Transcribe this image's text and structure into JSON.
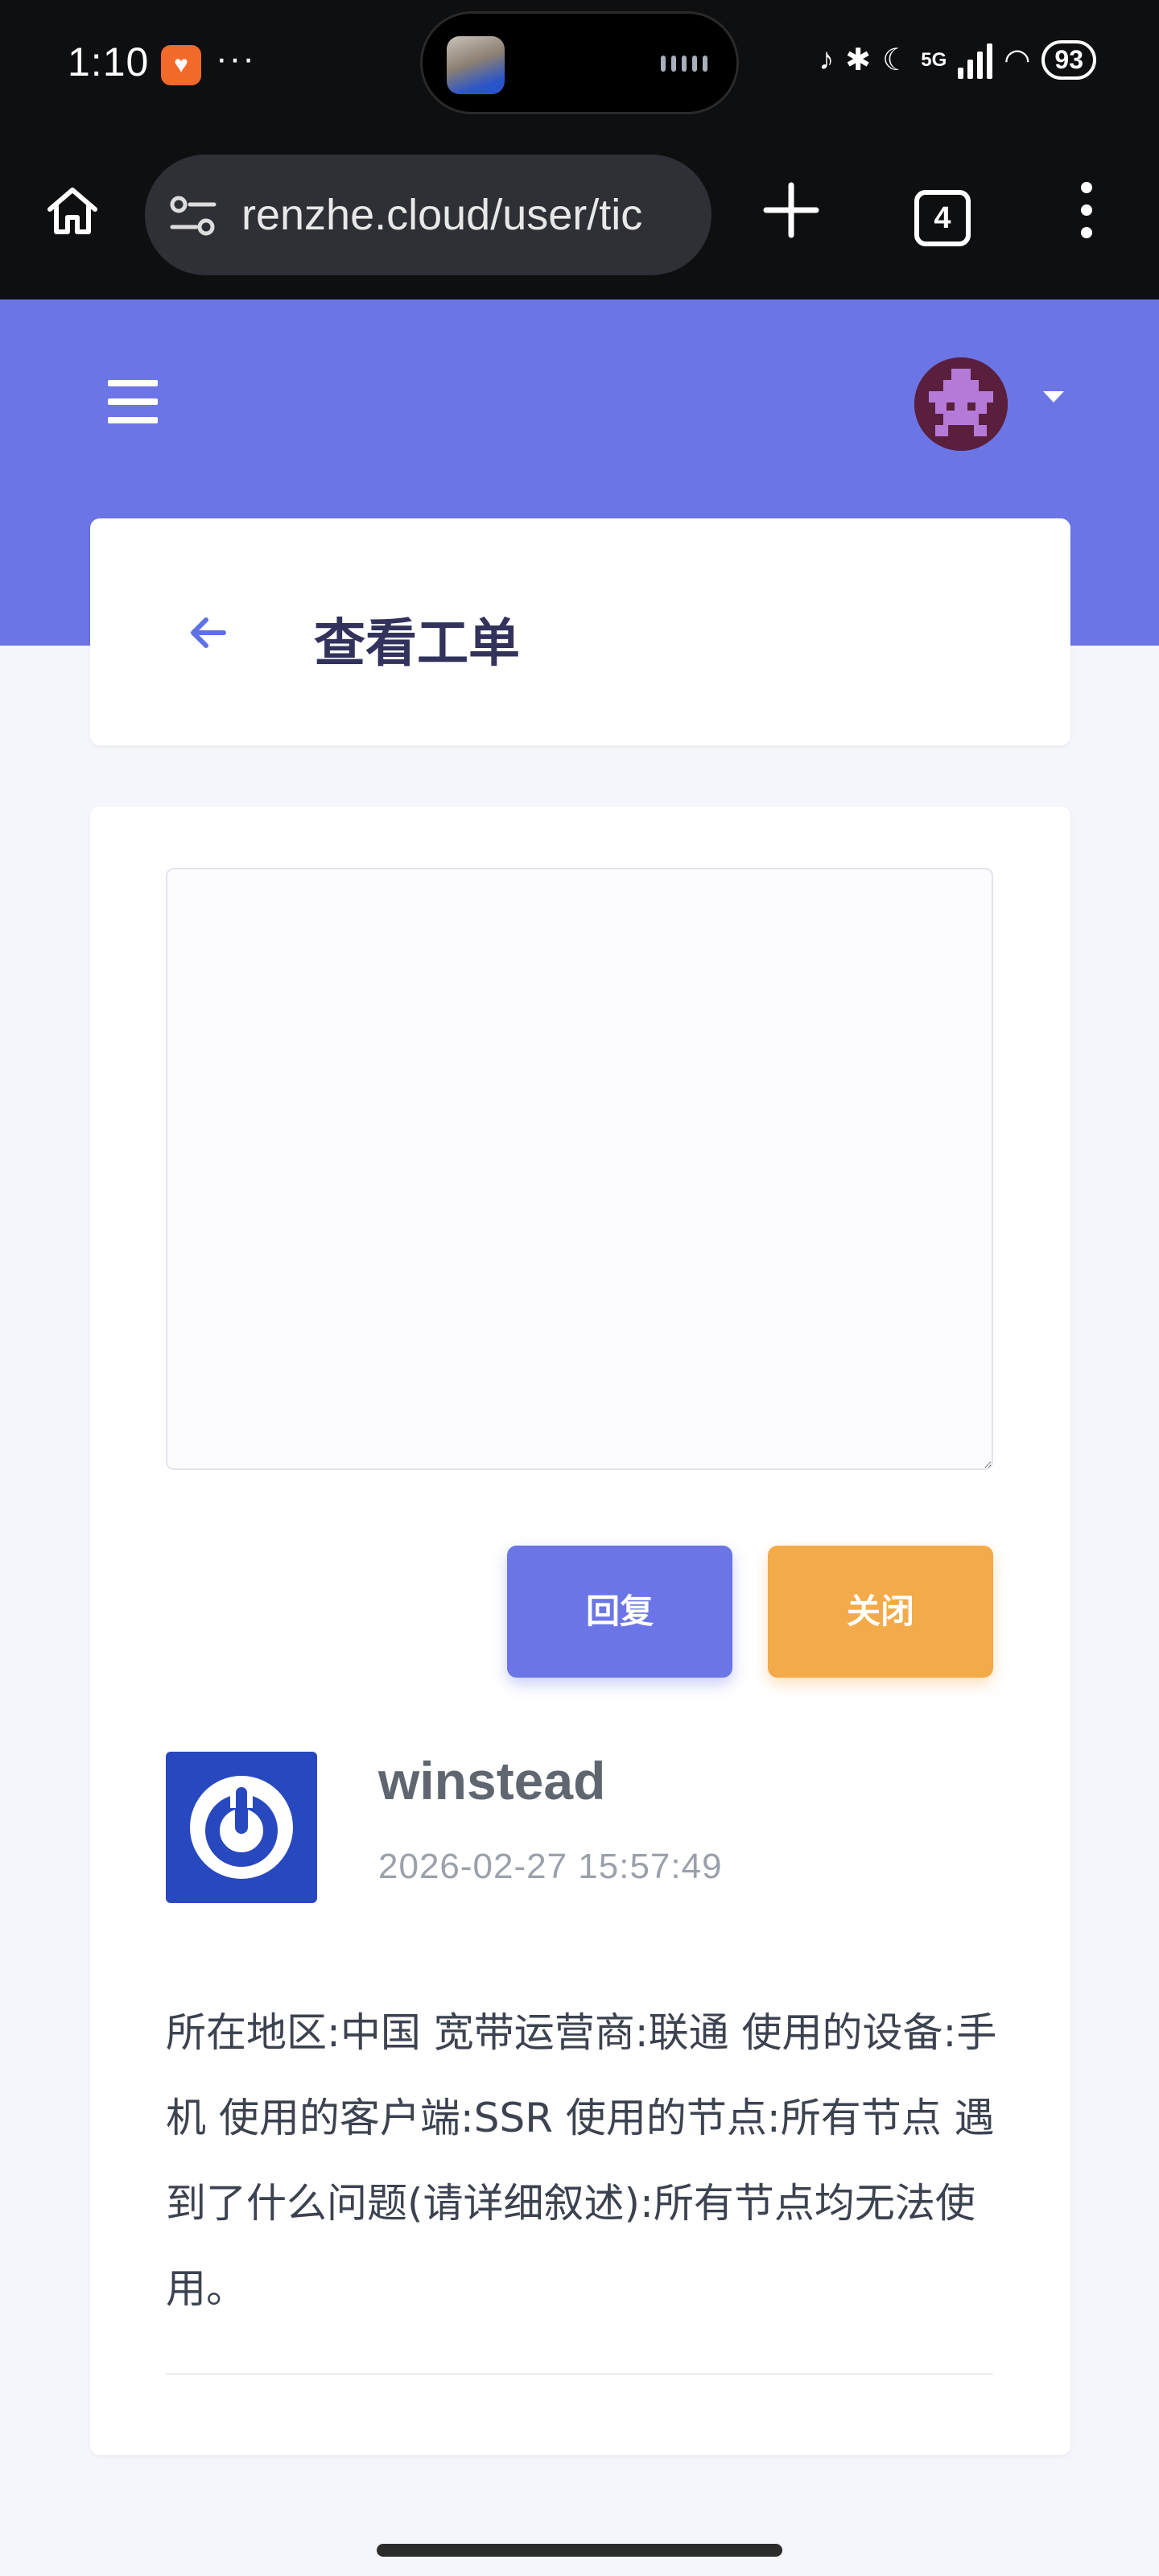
{
  "status_bar": {
    "time": "1:10",
    "more_dots": "···",
    "network": "5G",
    "battery": "93"
  },
  "browser": {
    "url": "renzhe.cloud/user/tic",
    "tab_count": "4"
  },
  "header": {
    "page_title": "查看工单"
  },
  "ticket": {
    "reply_placeholder": "",
    "reply_button": "回复",
    "close_button": "关闭",
    "message": {
      "username": "winstead",
      "timestamp": "2026-02-27 15:57:49",
      "body": "所在地区:中国 宽带运营商:联通 使用的设备:手机 使用的客户端:SSR 使用的节点:所有节点 遇到了什么问题(请详细叙述):所有节点均无法使用。"
    }
  },
  "colors": {
    "primary": "#6b75e5",
    "warning": "#f3aa48",
    "title": "#32325d"
  }
}
